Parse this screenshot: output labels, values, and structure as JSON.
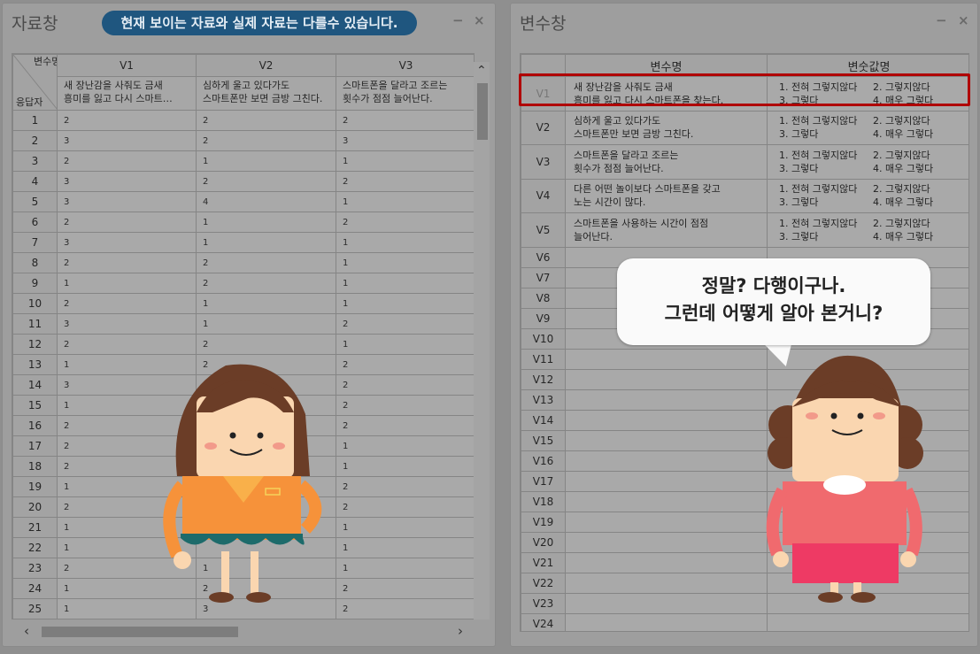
{
  "left_panel": {
    "title": "자료창",
    "notice": "현재 보이는 자료와 실제 자료는 다를수 있습니다.",
    "minimize": "−",
    "close": "×",
    "corner_top": "변수명",
    "corner_bottom": "응답자",
    "columns": [
      "V1",
      "V2",
      "V3"
    ],
    "descriptions": [
      "새 장난감을 사줘도 금새\n흥미를 잃고 다시 스마트…",
      "심하게 울고 있다가도\n스마트폰만 보면 금방 그친다.",
      "스마트폰을 달라고 조르는\n횟수가 점점 늘어난다."
    ],
    "rows": [
      {
        "n": "1",
        "v": [
          "2",
          "2",
          "2"
        ]
      },
      {
        "n": "2",
        "v": [
          "3",
          "2",
          "3"
        ]
      },
      {
        "n": "3",
        "v": [
          "2",
          "1",
          "1"
        ]
      },
      {
        "n": "4",
        "v": [
          "3",
          "2",
          "2"
        ]
      },
      {
        "n": "5",
        "v": [
          "3",
          "4",
          "1"
        ]
      },
      {
        "n": "6",
        "v": [
          "2",
          "1",
          "2"
        ]
      },
      {
        "n": "7",
        "v": [
          "3",
          "1",
          "1"
        ]
      },
      {
        "n": "8",
        "v": [
          "2",
          "2",
          "1"
        ]
      },
      {
        "n": "9",
        "v": [
          "1",
          "2",
          "1"
        ]
      },
      {
        "n": "10",
        "v": [
          "2",
          "1",
          "1"
        ]
      },
      {
        "n": "11",
        "v": [
          "3",
          "1",
          "2"
        ]
      },
      {
        "n": "12",
        "v": [
          "2",
          "2",
          "1"
        ]
      },
      {
        "n": "13",
        "v": [
          "1",
          "2",
          "2"
        ]
      },
      {
        "n": "14",
        "v": [
          "3",
          "",
          "2"
        ]
      },
      {
        "n": "15",
        "v": [
          "1",
          "",
          "2"
        ]
      },
      {
        "n": "16",
        "v": [
          "2",
          "",
          "2"
        ]
      },
      {
        "n": "17",
        "v": [
          "2",
          "",
          "1"
        ]
      },
      {
        "n": "18",
        "v": [
          "2",
          "",
          "1"
        ]
      },
      {
        "n": "19",
        "v": [
          "1",
          "",
          "2"
        ]
      },
      {
        "n": "20",
        "v": [
          "2",
          "",
          "2"
        ]
      },
      {
        "n": "21",
        "v": [
          "1",
          "",
          "1"
        ]
      },
      {
        "n": "22",
        "v": [
          "1",
          "",
          "1"
        ]
      },
      {
        "n": "23",
        "v": [
          "2",
          "1",
          "1"
        ]
      },
      {
        "n": "24",
        "v": [
          "1",
          "2",
          "2"
        ]
      },
      {
        "n": "25",
        "v": [
          "1",
          "3",
          "2"
        ]
      }
    ],
    "scroll_up": "⌃",
    "scroll_left": "‹",
    "scroll_right": "›"
  },
  "right_panel": {
    "title": "변수창",
    "minimize": "−",
    "close": "×",
    "headers": [
      "변수명",
      "변숫값명"
    ],
    "vars": [
      {
        "name": "V1",
        "desc": "새 장난감을 사줘도 금새\n흥미를 잃고 다시 스마트폰을 찾는다.",
        "vals": [
          "1. 전혀 그렇지않다",
          "2. 그렇지않다",
          "3. 그렇다",
          "4. 매우 그렇다"
        ]
      },
      {
        "name": "V2",
        "desc": "심하게 울고 있다가도\n스마트폰만 보면 금방 그친다.",
        "vals": [
          "1. 전혀 그렇지않다",
          "2. 그렇지않다",
          "3. 그렇다",
          "4. 매우 그렇다"
        ]
      },
      {
        "name": "V3",
        "desc": "스마트폰을 달라고 조르는\n횟수가 점점 늘어난다.",
        "vals": [
          "1. 전혀 그렇지않다",
          "2. 그렇지않다",
          "3. 그렇다",
          "4. 매우 그렇다"
        ]
      },
      {
        "name": "V4",
        "desc": "다른 어떤 놀이보다 스마트폰을 갖고\n노는 시간이 많다.",
        "vals": [
          "1. 전혀 그렇지않다",
          "2. 그렇지않다",
          "3. 그렇다",
          "4. 매우 그렇다"
        ]
      },
      {
        "name": "V5",
        "desc": "스마트폰을 사용하는 시간이 점점\n늘어난다.",
        "vals": [
          "1. 전혀 그렇지않다",
          "2. 그렇지않다",
          "3. 그렇다",
          "4. 매우 그렇다"
        ]
      }
    ],
    "empty_vars": [
      "V6",
      "V7",
      "V8",
      "V9",
      "V10",
      "V11",
      "V12",
      "V13",
      "V14",
      "V15",
      "V16",
      "V17",
      "V18",
      "V19",
      "V20",
      "V21",
      "V22",
      "V23",
      "V24"
    ]
  },
  "bubble": {
    "line1": "정말? 다행이구나.",
    "line2": "그런데 어떻게 알아 본거니?"
  },
  "colors": {
    "notice_bg": "#1f567f",
    "highlight": "#b00000",
    "girl_dress": "#f6923a",
    "woman_top": "#f06a6e",
    "woman_skirt": "#ee3a64"
  }
}
